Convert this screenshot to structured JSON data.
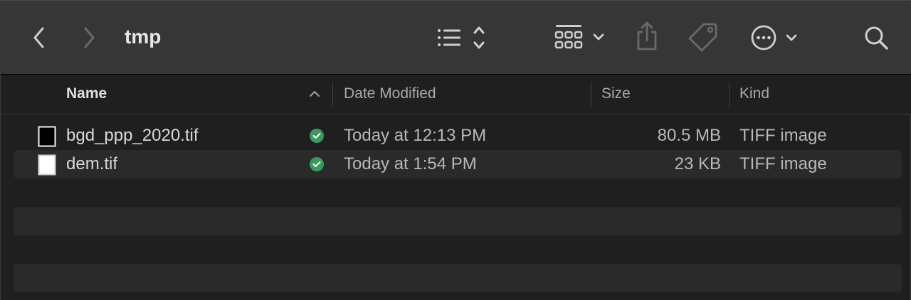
{
  "window": {
    "title": "tmp"
  },
  "toolbar": {
    "back_icon": "chevron-left-icon",
    "forward_icon": "chevron-right-icon",
    "view_list_icon": "list-view-icon",
    "group_icon": "grid-group-icon",
    "share_icon": "share-icon",
    "tag_icon": "tag-icon",
    "more_icon": "ellipsis-circle-icon",
    "search_icon": "magnifier-icon"
  },
  "columns": {
    "name": "Name",
    "date": "Date Modified",
    "size": "Size",
    "kind": "Kind"
  },
  "files": [
    {
      "name": "bgd_ppp_2020.tif",
      "date": "Today at 12:13 PM",
      "size": "80.5 MB",
      "kind": "TIFF image",
      "thumb": "black"
    },
    {
      "name": "dem.tif",
      "date": "Today at 1:54 PM",
      "size": "23 KB",
      "kind": "TIFF image",
      "thumb": "white"
    }
  ],
  "colors": {
    "toolbar_bg": "#363636",
    "window_bg": "#1f1f1f",
    "alt_row_bg": "#2a2a2a",
    "sync_ok": "#3a9a5c"
  }
}
